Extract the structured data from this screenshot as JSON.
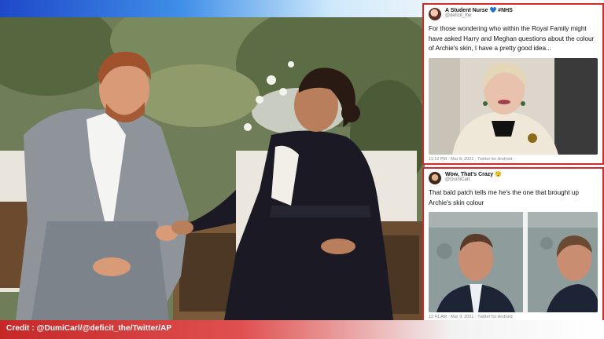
{
  "credit": "Credit : @DumiCarl/@deficit_the/Twitter/AP",
  "tweets": [
    {
      "display_name": "A Student Nurse 💙 #NHS",
      "handle": "@deficit_the",
      "text": "For those wondering who within the Royal Family might have asked Harry and Meghan questions about the colour of Archie's skin, I have a pretty good idea...",
      "meta": "11:12 PM · Mar 8, 2021 · Twitter for Android"
    },
    {
      "display_name": "Wow, That's Crazy 😯",
      "handle": "@DumiCarl",
      "text": "That bald patch tells me he's the one that brought up Archie's skin colour",
      "meta": "12:41 AM · Mar 9, 2021 · Twitter for Android"
    }
  ],
  "colors": {
    "accent_red": "#d22b2b",
    "top_blue": "#1f48c9"
  }
}
